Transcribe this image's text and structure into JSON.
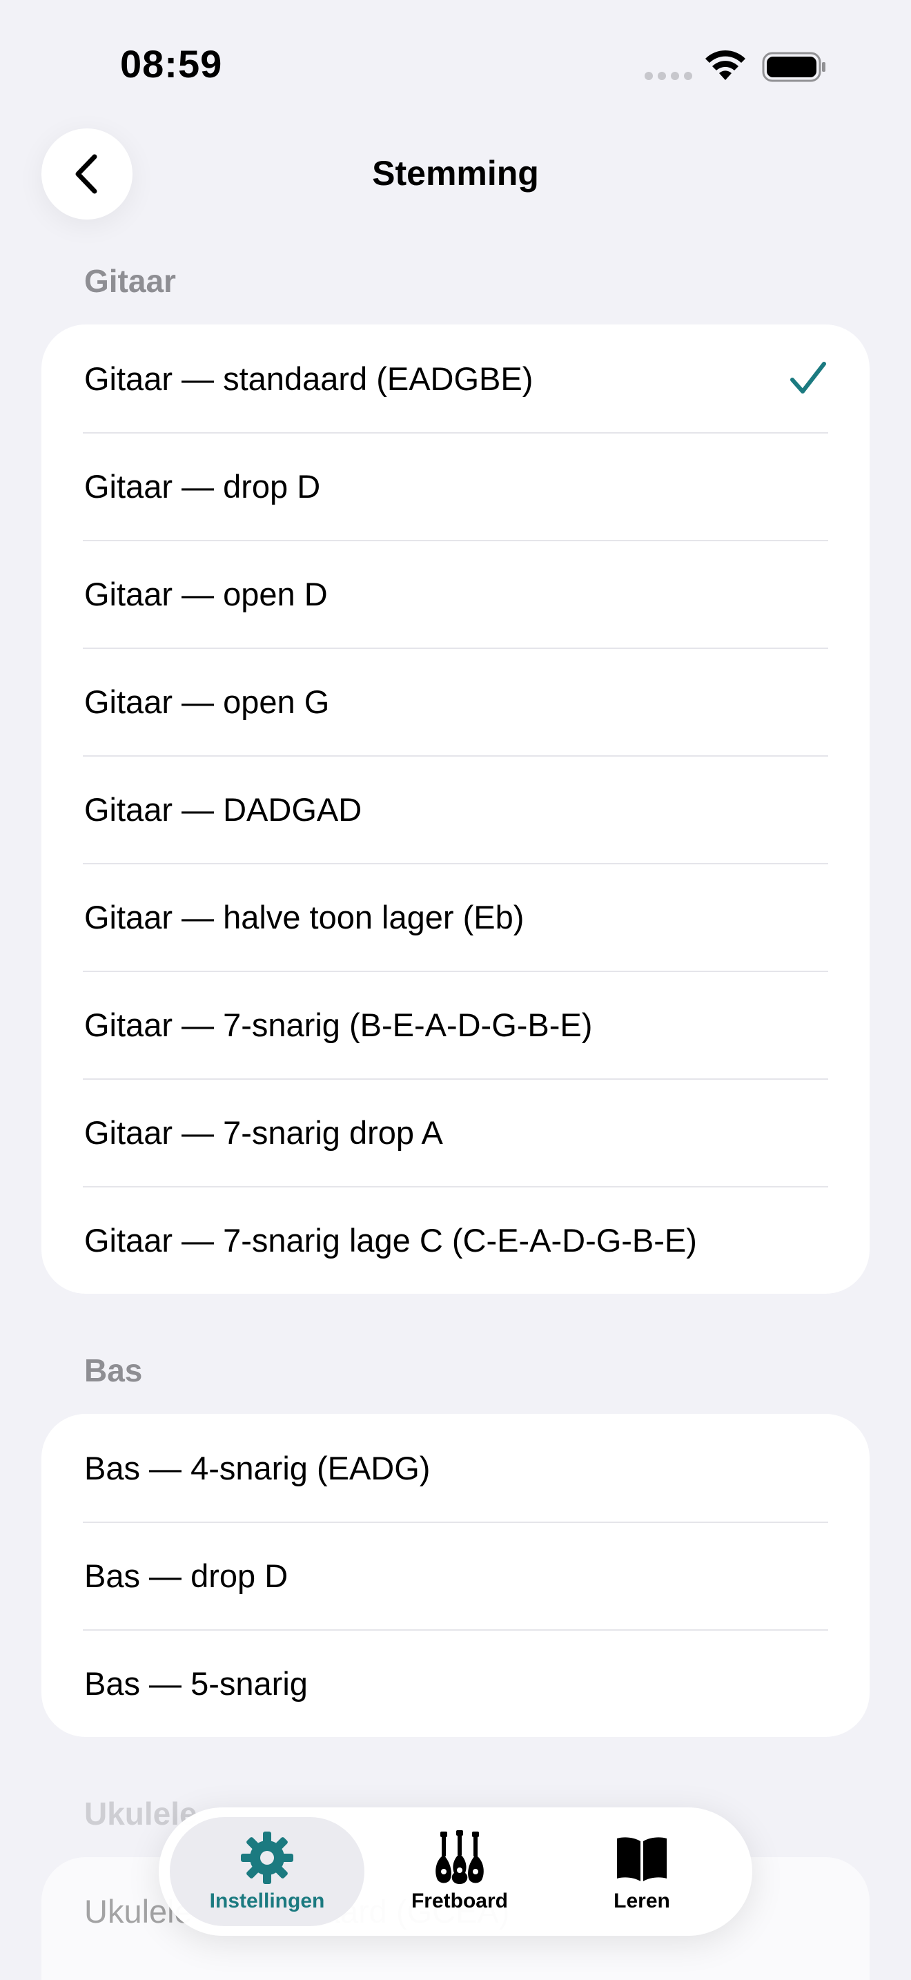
{
  "status": {
    "time": "08:59"
  },
  "nav": {
    "title": "Stemming"
  },
  "sections": {
    "guitar": {
      "header": "Gitaar",
      "items": [
        "Gitaar — standaard (EADGBE)",
        "Gitaar — drop D",
        "Gitaar — open D",
        "Gitaar — open G",
        "Gitaar — DADGAD",
        "Gitaar — halve toon lager (Eb)",
        "Gitaar — 7-snarig (B-E-A-D-G-B-E)",
        "Gitaar — 7-snarig drop A",
        "Gitaar — 7-snarig lage C (C-E-A-D-G-B-E)"
      ],
      "selected_index": 0
    },
    "bass": {
      "header": "Bas",
      "items": [
        "Bas — 4-snarig (EADG)",
        "Bas — drop D",
        "Bas — 5-snarig"
      ]
    },
    "ukulele": {
      "header": "Ukulele",
      "items": [
        "Ukulele — standaard (GCEA)"
      ]
    }
  },
  "tabbar": {
    "tabs": [
      {
        "label": "Instellingen",
        "icon": "gear-icon",
        "active": true
      },
      {
        "label": "Fretboard",
        "icon": "instruments-icon",
        "active": false
      },
      {
        "label": "Leren",
        "icon": "book-icon",
        "active": false
      }
    ]
  },
  "colors": {
    "accent": "#1B7A80",
    "background": "#F2F2F7",
    "separator": "#E5E5EA",
    "secondary_text": "#8E8E93"
  }
}
